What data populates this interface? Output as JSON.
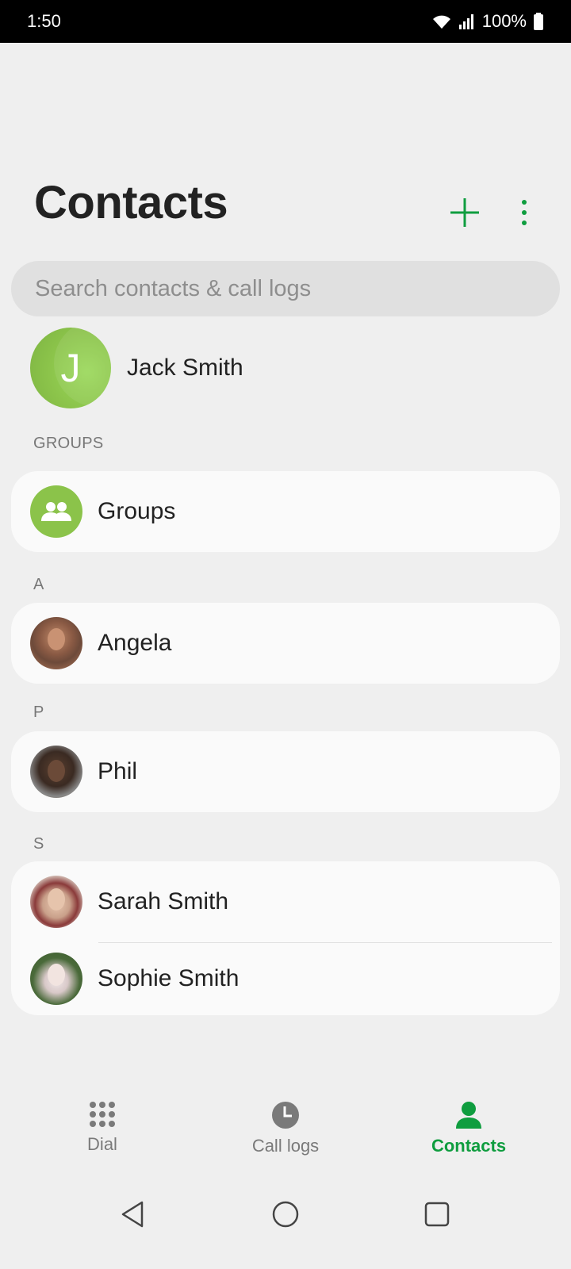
{
  "status_bar": {
    "time": "1:50",
    "battery": "100%",
    "icons": [
      "wifi-icon",
      "signal-icon",
      "battery-icon"
    ]
  },
  "header": {
    "title": "Contacts",
    "add_icon": "plus-icon",
    "more_icon": "more-vert-icon"
  },
  "search": {
    "placeholder": "Search contacts & call logs"
  },
  "profile": {
    "initial": "J",
    "name": "Jack Smith"
  },
  "sections": {
    "groups_header": "GROUPS",
    "groups_label": "Groups",
    "a_header": "A",
    "p_header": "P",
    "s_header": "S"
  },
  "contacts": {
    "angela": "Angela",
    "phil": "Phil",
    "sarah": "Sarah Smith",
    "sophie": "Sophie Smith"
  },
  "bottom_nav": {
    "dial": "Dial",
    "call_logs": "Call logs",
    "contacts": "Contacts",
    "active": "contacts"
  },
  "colors": {
    "accent": "#0f9d3f",
    "avatar_green": "#8bc34a",
    "background": "#efefef",
    "card": "#fafafa"
  }
}
